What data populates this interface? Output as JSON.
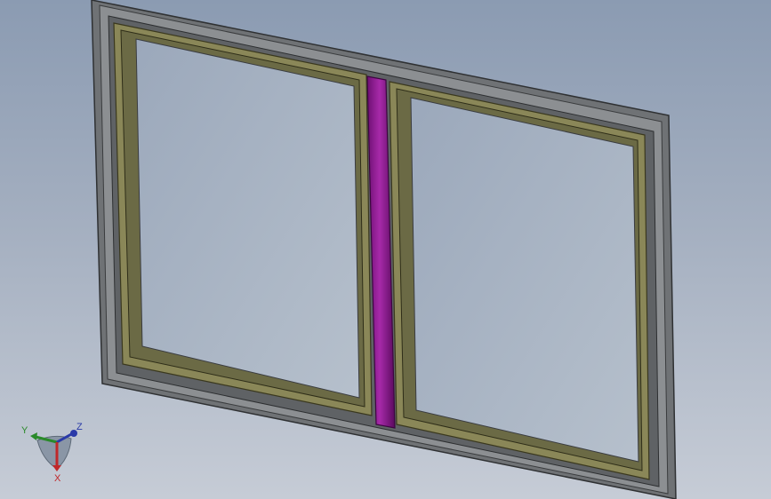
{
  "triad": {
    "x_label": "X",
    "y_label": "Y",
    "z_label": "Z"
  },
  "colors": {
    "background_top": "#8b9bb2",
    "background_bottom": "#c6ccd6",
    "outer_frame": "#6f7275",
    "sash_frame": "#8a8758",
    "glass": "#aab6c6",
    "mullion": "#8a1a8c",
    "axis_x": "#c0282a",
    "axis_y": "#2a8a2a",
    "axis_z": "#2a3aa8"
  },
  "icons": {
    "triad": "coordinate-triad-icon"
  }
}
